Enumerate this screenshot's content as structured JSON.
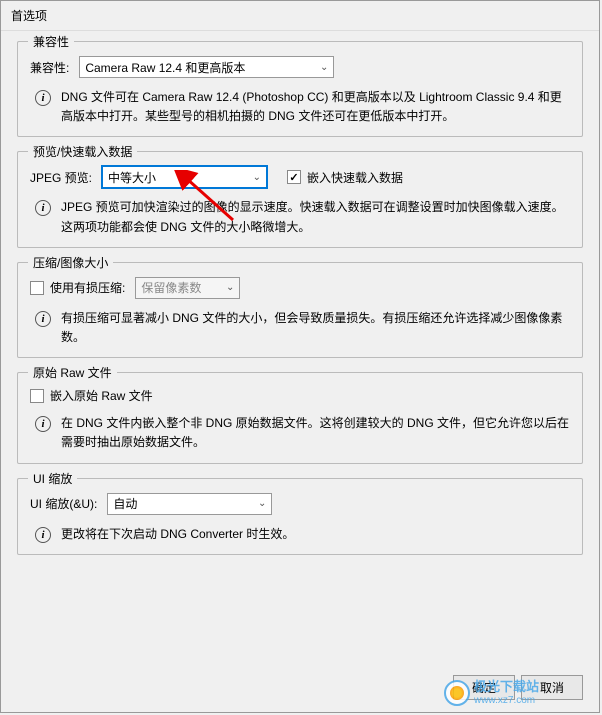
{
  "window": {
    "title": "首选项"
  },
  "compatibility": {
    "group_title": "兼容性",
    "label": "兼容性:",
    "value": "Camera Raw 12.4 和更高版本",
    "info": "DNG 文件可在 Camera Raw 12.4 (Photoshop CC) 和更高版本以及 Lightroom Classic 9.4 和更高版本中打开。某些型号的相机拍摄的 DNG 文件还可在更低版本中打开。"
  },
  "preview": {
    "group_title": "预览/快速载入数据",
    "label": "JPEG 预览:",
    "value": "中等大小",
    "checkbox_label": "嵌入快速载入数据",
    "info": "JPEG 预览可加快渲染过的图像的显示速度。快速载入数据可在调整设置时加快图像载入速度。这两项功能都会使 DNG 文件的大小略微增大。"
  },
  "compression": {
    "group_title": "压缩/图像大小",
    "checkbox_label": "使用有损压缩:",
    "select_value": "保留像素数",
    "info": "有损压缩可显著减小 DNG 文件的大小，但会导致质量损失。有损压缩还允许选择减少图像像素数。"
  },
  "raw": {
    "group_title": "原始 Raw 文件",
    "checkbox_label": "嵌入原始 Raw 文件",
    "info": "在 DNG 文件内嵌入整个非 DNG 原始数据文件。这将创建较大的 DNG 文件，但它允许您以后在需要时抽出原始数据文件。"
  },
  "ui_scale": {
    "group_title": "UI 缩放",
    "label": "UI 缩放(&U):",
    "value": "自动",
    "info": "更改将在下次启动 DNG Converter 时生效。"
  },
  "buttons": {
    "ok": "确定",
    "cancel": "取消"
  },
  "watermark": {
    "name": "极光下载站",
    "url": "www.xz7.com"
  }
}
